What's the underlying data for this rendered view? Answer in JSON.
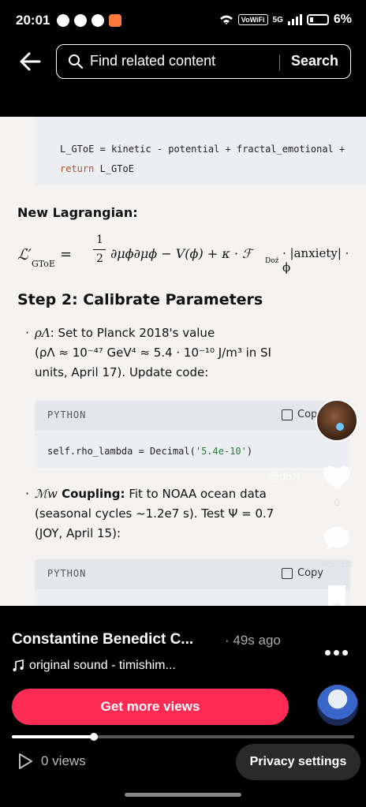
{
  "status_bar": {
    "time": "20:01",
    "volte": "VoWiFi",
    "network": "5G",
    "battery": "6%"
  },
  "search": {
    "placeholder": "Find related content",
    "button": "Search"
  },
  "content": {
    "code_line1": "L_GToE = kinetic - potential + fractal_emotional +",
    "code_line2_kw": "return",
    "code_line2_rest": " L_GToE",
    "new_lagrangian_heading": "New Lagrangian:",
    "formula": {
      "lhs": "ℒ′",
      "lhs_sub": "GToE",
      "eq": " = ",
      "frac_num": "1",
      "frac_den": "2",
      "rest": "∂μϕ∂μϕ − V(ϕ) + κ · ℱ",
      "rest_sub": "Doź",
      "tail": " · |anxiety| · ϕ"
    },
    "step2_heading": "Step 2: Calibrate Parameters",
    "item1": {
      "symbol": "ρΛ",
      "line1": ": Set to Planck 2018's value",
      "line2": "(ρΛ ≈ 10⁻⁴⁷ GeV⁴ ≈ 5.4 · 10⁻¹⁰ J/m³  in SI",
      "line3": "units, April 17). Update code:"
    },
    "code1": {
      "lang": "PYTHON",
      "copy": "Copy",
      "prefix": "self.rho_lambda = Decimal(",
      "string": "'5.4e-10'",
      "suffix": ")"
    },
    "item2": {
      "symbol": "ℳw",
      "label": " Coupling:",
      "line1": " Fit to NOAA ocean data",
      "line2": "(seasonal cycles ~1.2e7 s). Test  Ψ = 0.7",
      "line3": "(JOY, April 15):"
    },
    "code2": {
      "lang": "PYTHON",
      "copy": "Copy"
    }
  },
  "actions": {
    "likes": "0",
    "comments": "Add 1st",
    "saves": "0",
    "watermark": "@dozi..."
  },
  "bottom": {
    "author": "Constantine Benedict C...",
    "time_ago": "· 49s ago",
    "sound": "original sound - timishim...",
    "cta": "Get more views",
    "views": "0 views",
    "privacy": "Privacy settings",
    "progress": 0.24
  }
}
